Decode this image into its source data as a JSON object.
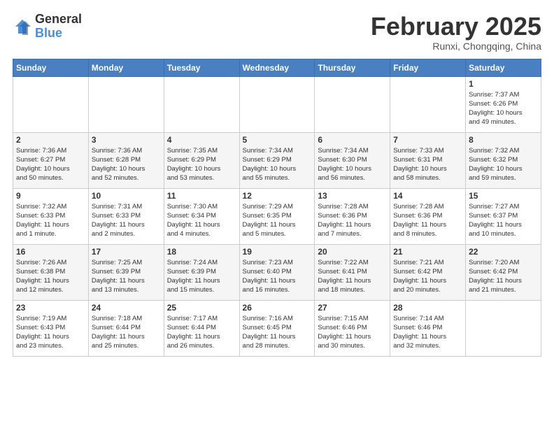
{
  "logo": {
    "general": "General",
    "blue": "Blue"
  },
  "title": "February 2025",
  "location": "Runxi, Chongqing, China",
  "weekdays": [
    "Sunday",
    "Monday",
    "Tuesday",
    "Wednesday",
    "Thursday",
    "Friday",
    "Saturday"
  ],
  "weeks": [
    [
      {
        "day": "",
        "info": ""
      },
      {
        "day": "",
        "info": ""
      },
      {
        "day": "",
        "info": ""
      },
      {
        "day": "",
        "info": ""
      },
      {
        "day": "",
        "info": ""
      },
      {
        "day": "",
        "info": ""
      },
      {
        "day": "1",
        "info": "Sunrise: 7:37 AM\nSunset: 6:26 PM\nDaylight: 10 hours\nand 49 minutes."
      }
    ],
    [
      {
        "day": "2",
        "info": "Sunrise: 7:36 AM\nSunset: 6:27 PM\nDaylight: 10 hours\nand 50 minutes."
      },
      {
        "day": "3",
        "info": "Sunrise: 7:36 AM\nSunset: 6:28 PM\nDaylight: 10 hours\nand 52 minutes."
      },
      {
        "day": "4",
        "info": "Sunrise: 7:35 AM\nSunset: 6:29 PM\nDaylight: 10 hours\nand 53 minutes."
      },
      {
        "day": "5",
        "info": "Sunrise: 7:34 AM\nSunset: 6:29 PM\nDaylight: 10 hours\nand 55 minutes."
      },
      {
        "day": "6",
        "info": "Sunrise: 7:34 AM\nSunset: 6:30 PM\nDaylight: 10 hours\nand 56 minutes."
      },
      {
        "day": "7",
        "info": "Sunrise: 7:33 AM\nSunset: 6:31 PM\nDaylight: 10 hours\nand 58 minutes."
      },
      {
        "day": "8",
        "info": "Sunrise: 7:32 AM\nSunset: 6:32 PM\nDaylight: 10 hours\nand 59 minutes."
      }
    ],
    [
      {
        "day": "9",
        "info": "Sunrise: 7:32 AM\nSunset: 6:33 PM\nDaylight: 11 hours\nand 1 minute."
      },
      {
        "day": "10",
        "info": "Sunrise: 7:31 AM\nSunset: 6:33 PM\nDaylight: 11 hours\nand 2 minutes."
      },
      {
        "day": "11",
        "info": "Sunrise: 7:30 AM\nSunset: 6:34 PM\nDaylight: 11 hours\nand 4 minutes."
      },
      {
        "day": "12",
        "info": "Sunrise: 7:29 AM\nSunset: 6:35 PM\nDaylight: 11 hours\nand 5 minutes."
      },
      {
        "day": "13",
        "info": "Sunrise: 7:28 AM\nSunset: 6:36 PM\nDaylight: 11 hours\nand 7 minutes."
      },
      {
        "day": "14",
        "info": "Sunrise: 7:28 AM\nSunset: 6:36 PM\nDaylight: 11 hours\nand 8 minutes."
      },
      {
        "day": "15",
        "info": "Sunrise: 7:27 AM\nSunset: 6:37 PM\nDaylight: 11 hours\nand 10 minutes."
      }
    ],
    [
      {
        "day": "16",
        "info": "Sunrise: 7:26 AM\nSunset: 6:38 PM\nDaylight: 11 hours\nand 12 minutes."
      },
      {
        "day": "17",
        "info": "Sunrise: 7:25 AM\nSunset: 6:39 PM\nDaylight: 11 hours\nand 13 minutes."
      },
      {
        "day": "18",
        "info": "Sunrise: 7:24 AM\nSunset: 6:39 PM\nDaylight: 11 hours\nand 15 minutes."
      },
      {
        "day": "19",
        "info": "Sunrise: 7:23 AM\nSunset: 6:40 PM\nDaylight: 11 hours\nand 16 minutes."
      },
      {
        "day": "20",
        "info": "Sunrise: 7:22 AM\nSunset: 6:41 PM\nDaylight: 11 hours\nand 18 minutes."
      },
      {
        "day": "21",
        "info": "Sunrise: 7:21 AM\nSunset: 6:42 PM\nDaylight: 11 hours\nand 20 minutes."
      },
      {
        "day": "22",
        "info": "Sunrise: 7:20 AM\nSunset: 6:42 PM\nDaylight: 11 hours\nand 21 minutes."
      }
    ],
    [
      {
        "day": "23",
        "info": "Sunrise: 7:19 AM\nSunset: 6:43 PM\nDaylight: 11 hours\nand 23 minutes."
      },
      {
        "day": "24",
        "info": "Sunrise: 7:18 AM\nSunset: 6:44 PM\nDaylight: 11 hours\nand 25 minutes."
      },
      {
        "day": "25",
        "info": "Sunrise: 7:17 AM\nSunset: 6:44 PM\nDaylight: 11 hours\nand 26 minutes."
      },
      {
        "day": "26",
        "info": "Sunrise: 7:16 AM\nSunset: 6:45 PM\nDaylight: 11 hours\nand 28 minutes."
      },
      {
        "day": "27",
        "info": "Sunrise: 7:15 AM\nSunset: 6:46 PM\nDaylight: 11 hours\nand 30 minutes."
      },
      {
        "day": "28",
        "info": "Sunrise: 7:14 AM\nSunset: 6:46 PM\nDaylight: 11 hours\nand 32 minutes."
      },
      {
        "day": "",
        "info": ""
      }
    ]
  ]
}
